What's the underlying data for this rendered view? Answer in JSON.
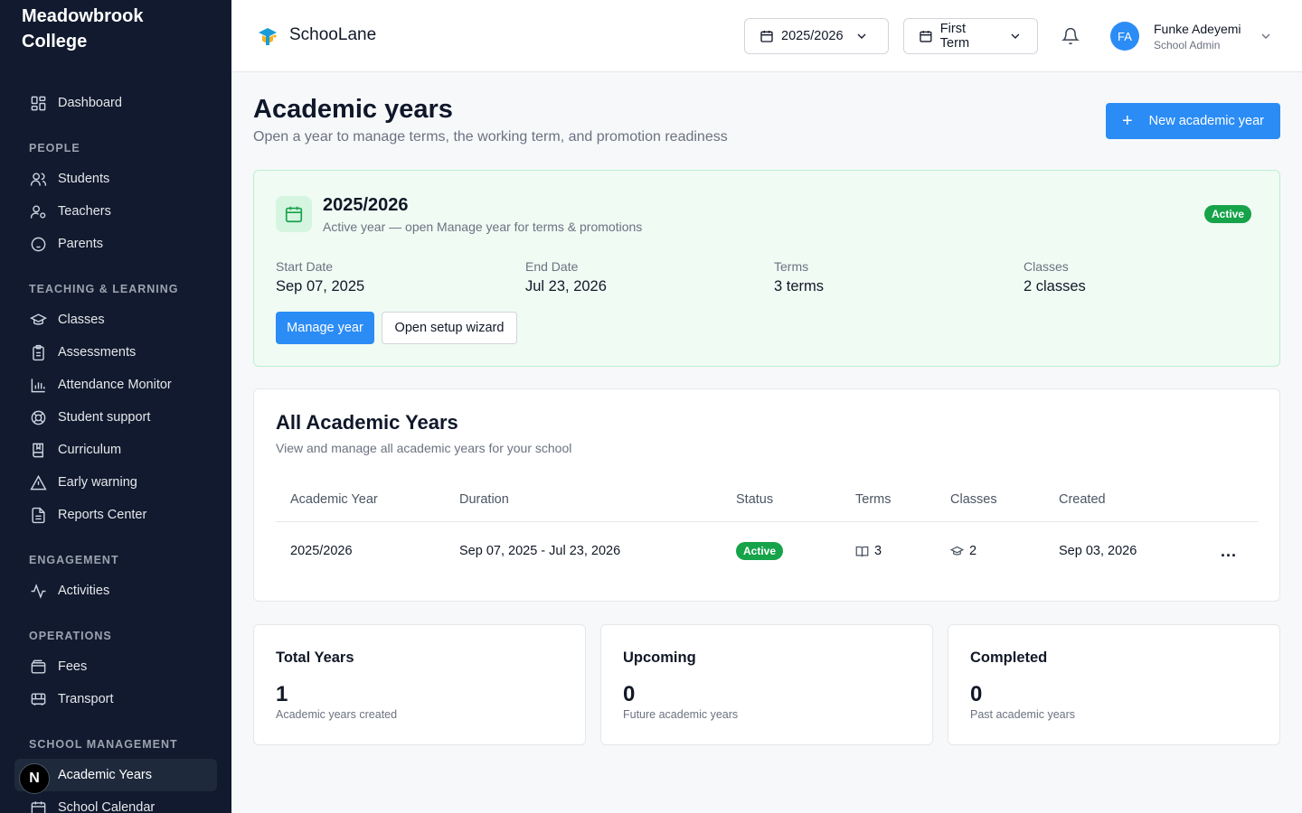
{
  "school_name": "Meadowbrook College",
  "app_name": "SchooLane",
  "sidebar": {
    "dashboard": "Dashboard",
    "sections": {
      "people": "PEOPLE",
      "teaching": "TEACHING & LEARNING",
      "engagement": "ENGAGEMENT",
      "operations": "OPERATIONS",
      "school_management": "SCHOOL MANAGEMENT"
    },
    "people": [
      "Students",
      "Teachers",
      "Parents"
    ],
    "teaching": [
      "Classes",
      "Assessments",
      "Attendance Monitor",
      "Student support",
      "Curriculum",
      "Early warning",
      "Reports Center"
    ],
    "engagement": [
      "Activities"
    ],
    "operations": [
      "Fees",
      "Transport"
    ],
    "school_management": [
      "Academic Years",
      "School Calendar"
    ],
    "dev_badge": "N"
  },
  "header": {
    "year_select": "2025/2026",
    "term_select": "First Term",
    "user": {
      "initials": "FA",
      "name": "Funke Adeyemi",
      "role": "School Admin"
    }
  },
  "page": {
    "title": "Academic years",
    "subtitle": "Open a year to manage terms, the working term, and promotion readiness",
    "new_button": "New academic year"
  },
  "active_year": {
    "title": "2025/2026",
    "subtitle": "Active year — open Manage year for terms & promotions",
    "badge": "Active",
    "stats": [
      {
        "label": "Start Date",
        "value": "Sep 07, 2025"
      },
      {
        "label": "End Date",
        "value": "Jul 23, 2026"
      },
      {
        "label": "Terms",
        "value": "3 terms"
      },
      {
        "label": "Classes",
        "value": "2 classes"
      }
    ],
    "manage_button": "Manage year",
    "wizard_button": "Open setup wizard"
  },
  "years_table": {
    "title": "All Academic Years",
    "subtitle": "View and manage all academic years for your school",
    "columns": [
      "Academic Year",
      "Duration",
      "Status",
      "Terms",
      "Classes",
      "Created"
    ],
    "rows": [
      {
        "year": "2025/2026",
        "duration": "Sep 07, 2025 - Jul 23, 2026",
        "status": "Active",
        "terms": "3",
        "classes": "2",
        "created": "Sep 03, 2026",
        "actions": "..."
      }
    ]
  },
  "summary": [
    {
      "title": "Total Years",
      "value": "1",
      "note": "Academic years created"
    },
    {
      "title": "Upcoming",
      "value": "0",
      "note": "Future academic years"
    },
    {
      "title": "Completed",
      "value": "0",
      "note": "Past academic years"
    }
  ],
  "colors": {
    "sidebar_bg": "#111a2e",
    "primary": "#2b8cf5",
    "success": "#16a34a",
    "active_card_bg": "#f0fbf4"
  }
}
